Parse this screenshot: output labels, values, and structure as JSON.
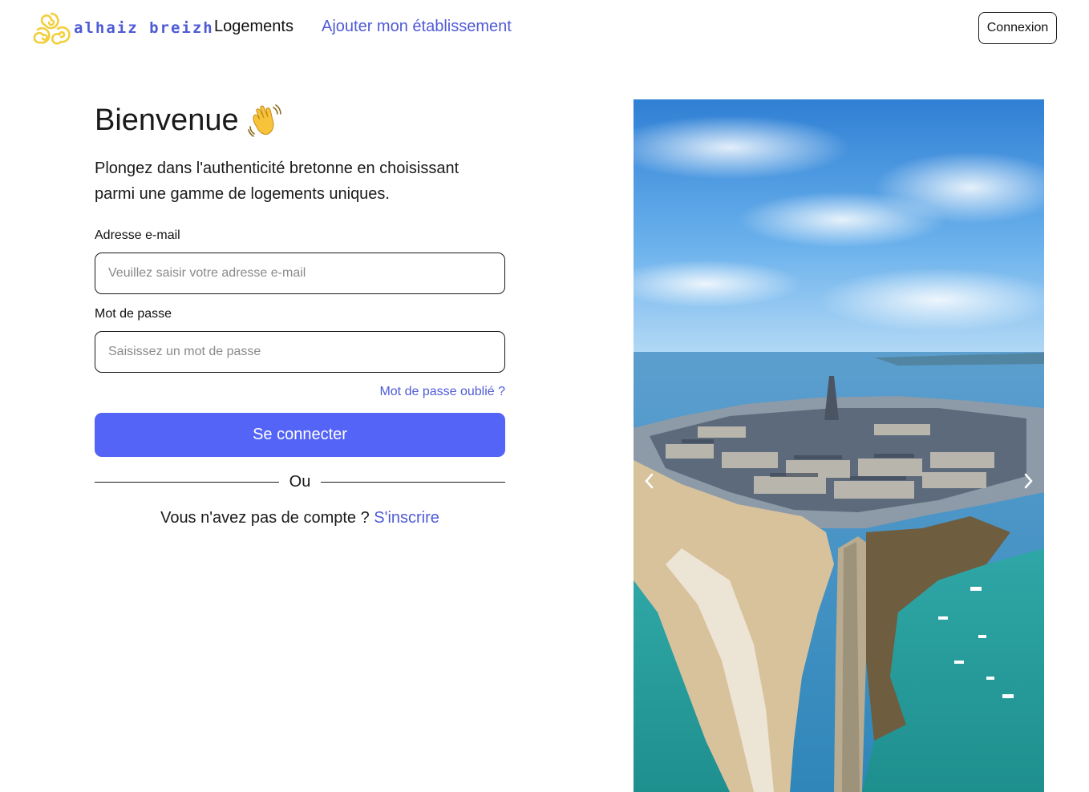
{
  "header": {
    "logo_text": "alhaiz breizh",
    "nav": {
      "logements": "Logements",
      "ajouter": "Ajouter mon établissement"
    },
    "login_button": "Connexion"
  },
  "form": {
    "title": "Bienvenue",
    "intro": "Plongez dans l'authenticité bretonne en choisissant parmi une gamme de logements uniques.",
    "email": {
      "label": "Adresse e-mail",
      "placeholder": "Veuillez saisir votre adresse e-mail",
      "value": ""
    },
    "password": {
      "label": "Mot de passe",
      "placeholder": "Saisissez un mot de passe",
      "value": ""
    },
    "forgot": "Mot de passe oublié ?",
    "submit": "Se connecter",
    "divider": "Ou",
    "signup_prompt": "Vous n'avez pas de compte ?",
    "signup_link": "S'inscrire"
  },
  "carousel": {
    "image": "aerial-coastal-walled-town-photo",
    "prev_icon": "chevron-left-icon",
    "next_icon": "chevron-right-icon"
  },
  "colors": {
    "accent": "#4f5bd5",
    "button": "#5464f7",
    "logo_yellow": "#f2cf3c",
    "text": "#1a1a1a"
  }
}
